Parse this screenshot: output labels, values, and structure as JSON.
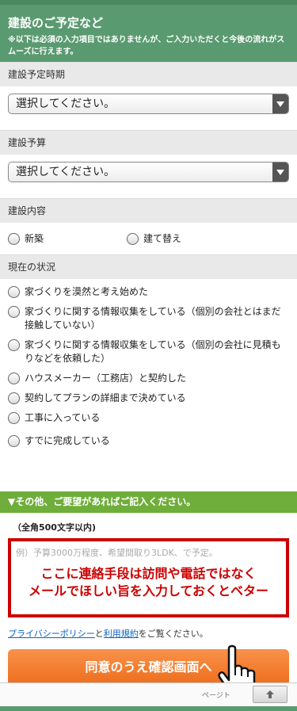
{
  "header": {
    "title": "建設のご予定など",
    "note": "※以下は必須の入力項目ではありませんが、ご入力いただくと今後の流れがスムーズに行えます。"
  },
  "schedule": {
    "label": "建設予定時期",
    "selected": "選択してください。"
  },
  "budget": {
    "label": "建設予算",
    "selected": "選択してください。"
  },
  "content": {
    "label": "建設内容",
    "options": [
      "新築",
      "建て替え"
    ]
  },
  "status": {
    "label": "現在の状況",
    "options": [
      "家づくりを漠然と考え始めた",
      "家づくりに関する情報収集をしている（個別の会社とはまだ接触していない）",
      "家づくりに関する情報収集をしている（個別の会社に見積もりなどを依頼した）",
      "ハウスメーカー（工務店）と契約した",
      "契約してプランの詳細まで決めている",
      "工事に入っている",
      "すでに完成している"
    ]
  },
  "request": {
    "heading": "▼その他、ご要望があればご記入ください。",
    "limit": "（全角500文字以内)",
    "placeholder": "例）予算3000万程度、希望間取り3LDK、で予定。",
    "overlay_line1": "ここに連絡手段は訪問や電話ではなく",
    "overlay_line2": "メールでほしい旨を入力しておくとベター"
  },
  "policy": {
    "privacy_link": "プライバシーポリシー",
    "and": "と",
    "terms_link": "利用規約",
    "suffix": "をご覧ください。"
  },
  "submit": {
    "label": "同意のうえ確認画面へ"
  },
  "footer": {
    "page_top": "ページト",
    "top_icon": "arrow-up-icon"
  },
  "colors": {
    "header_green": "#5a9a70",
    "bar_green": "#6fae3a",
    "button_orange": "#ee6d1c",
    "alert_red": "#cc0000",
    "link_blue": "#0b62c4"
  }
}
